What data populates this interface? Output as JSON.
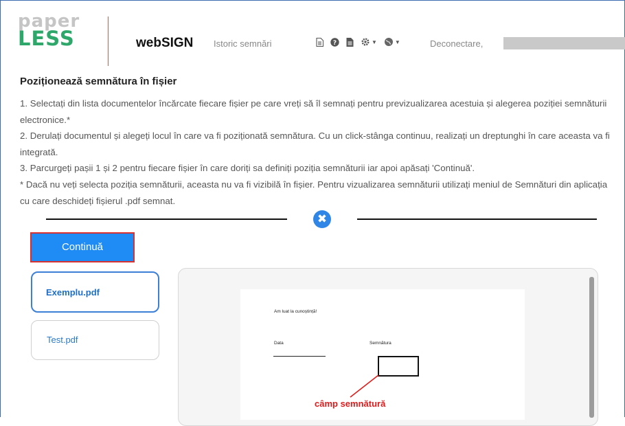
{
  "header": {
    "logo_top": "paper",
    "logo_bottom": "LESS",
    "brand": "webSIGN",
    "history_link": "Istoric semnări",
    "logout_link": "Deconectare,",
    "icons": [
      "document-icon",
      "help-icon",
      "file-icon",
      "gear-icon",
      "globe-icon"
    ]
  },
  "main": {
    "heading": "Poziționează semnătura în fișier",
    "instructions": [
      "1. Selectați din lista documentelor încărcate fiecare fișier pe care vreți să îl semnați pentru previzualizarea acestuia și alegerea poziției semnăturii electronice.*",
      "2. Derulați documentul și alegeți locul în care va fi poziționată semnătura. Cu un click-stânga continuu, realizați un dreptunghi în care aceasta va fi integrată.",
      "3. Parcurgeți pașii 1 și 2 pentru fiecare fișier în care doriți sa definiți poziția semnăturii iar apoi apăsați 'Continuă'.",
      "* Dacă nu veți selecta poziția semnăturii, aceasta nu va fi vizibilă în fișier. Pentru vizualizarea semnăturii utilizați meniul de Semnături din aplicația cu care deschideți fișierul .pdf semnat."
    ],
    "continue_label": "Continuă",
    "close_symbol": "✖",
    "files": [
      {
        "name": "Exemplu.pdf",
        "selected": true
      },
      {
        "name": "Test.pdf",
        "selected": false
      }
    ]
  },
  "preview": {
    "ack_text": "Am luat la cunoștință!",
    "date_label": "Data",
    "signature_label": "Semnătura",
    "annotation": "câmp semnătură"
  },
  "colors": {
    "primary": "#1f8bf4",
    "highlight_border": "#d93030",
    "logo_green": "#2ea86a",
    "annotation_red": "#e01b1b"
  }
}
